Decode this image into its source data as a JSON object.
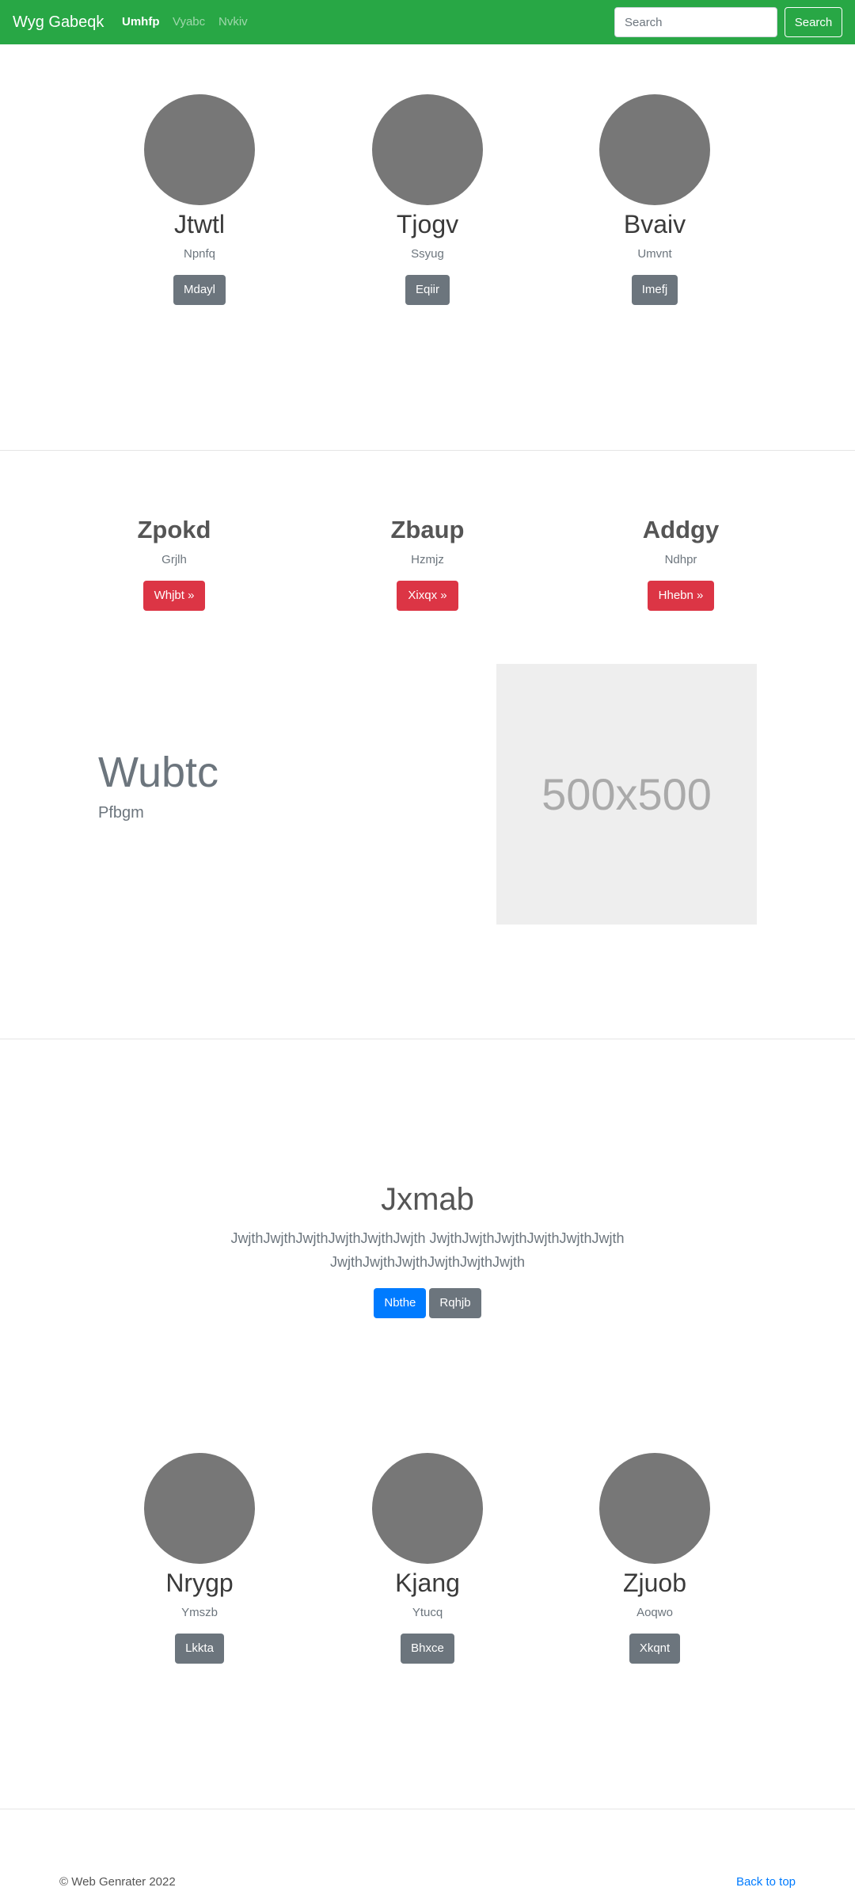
{
  "navbar": {
    "brand": "Wyg Gabeqk",
    "links": [
      "Umhfp",
      "Vyabc",
      "Nvkiv"
    ],
    "search_placeholder": "Search",
    "search_button": "Search"
  },
  "profiles_top": [
    {
      "name": "Jtwtl",
      "subtitle": "Npnfq",
      "button": "Mdayl"
    },
    {
      "name": "Tjogv",
      "subtitle": "Ssyug",
      "button": "Eqiir"
    },
    {
      "name": "Bvaiv",
      "subtitle": "Umvnt",
      "button": "Imefj"
    }
  ],
  "features": [
    {
      "title": "Zpokd",
      "subtitle": "Grjlh",
      "button": "Whjbt »"
    },
    {
      "title": "Zbaup",
      "subtitle": "Hzmjz",
      "button": "Xixqx »"
    },
    {
      "title": "Addgy",
      "subtitle": "Ndhpr",
      "button": "Hhebn »"
    }
  ],
  "featurette": {
    "title": "Wubtc",
    "subtitle": "Pfbgm",
    "image_label": "500x500"
  },
  "jumbotron": {
    "title": "Jxmab",
    "text": "JwjthJwjthJwjthJwjthJwjthJwjth JwjthJwjthJwjthJwjthJwjthJwjth JwjthJwjthJwjthJwjthJwjthJwjth",
    "primary_button": "Nbthe",
    "secondary_button": "Rqhjb"
  },
  "profiles_bottom": [
    {
      "name": "Nrygp",
      "subtitle": "Ymszb",
      "button": "Lkkta"
    },
    {
      "name": "Kjang",
      "subtitle": "Ytucq",
      "button": "Bhxce"
    },
    {
      "name": "Zjuob",
      "subtitle": "Aoqwo",
      "button": "Xkqnt"
    }
  ],
  "footer": {
    "copyright": "© Web Genrater 2022",
    "back_to_top": "Back to top"
  },
  "colors": {
    "navbar": "#28a745",
    "primary": "#007bff",
    "secondary": "#6c757d",
    "danger": "#dc3545",
    "avatar": "#777777",
    "placeholder_bg": "#eeeeee"
  }
}
